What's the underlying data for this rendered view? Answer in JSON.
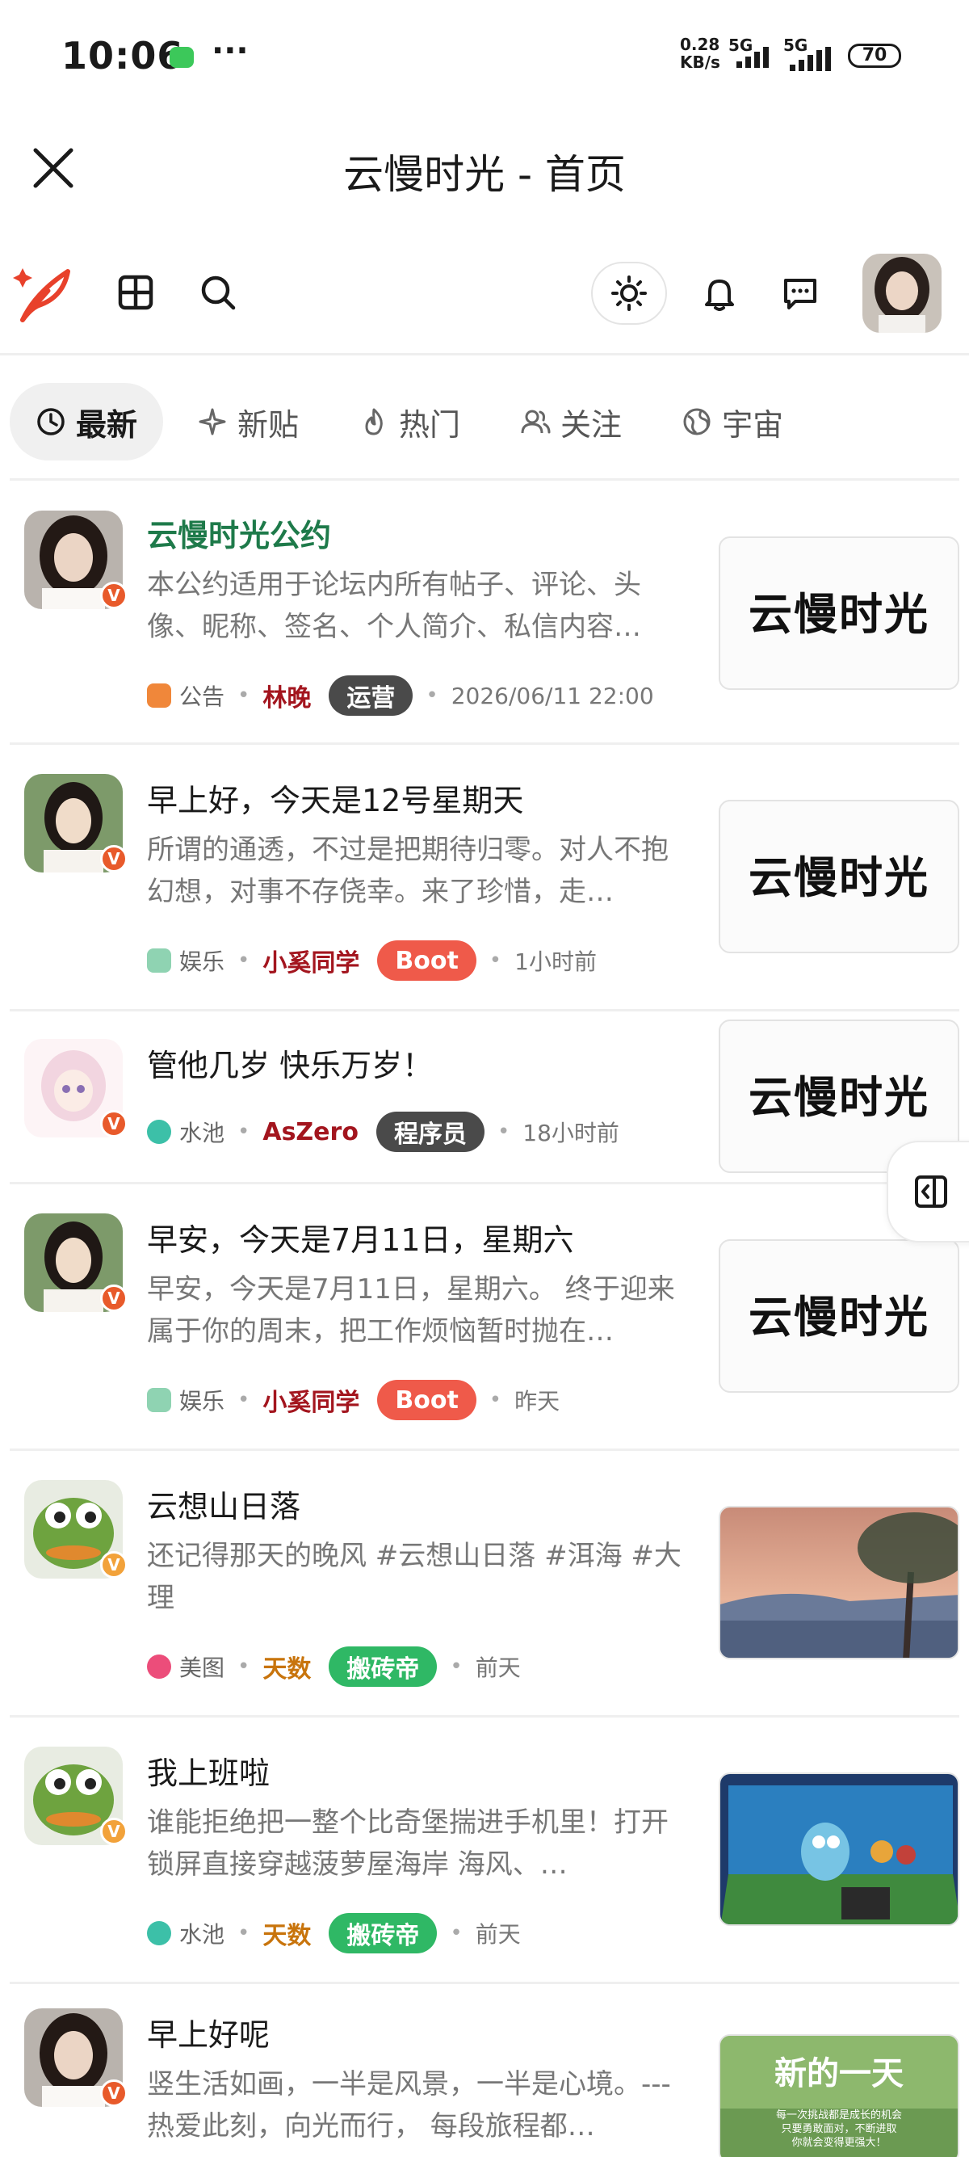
{
  "status": {
    "time": "10:06",
    "speed_top": "0.28",
    "speed_bottom": "KB/s",
    "sig1": "5G",
    "sig2": "5G",
    "battery": "70"
  },
  "header": {
    "title": "云慢时光 - 首页"
  },
  "tabs": [
    {
      "label": "最新",
      "icon": "clock-icon",
      "active": true
    },
    {
      "label": "新贴",
      "icon": "sparkle-icon",
      "active": false
    },
    {
      "label": "热门",
      "icon": "flame-icon",
      "active": false
    },
    {
      "label": "关注",
      "icon": "users-icon",
      "active": false
    },
    {
      "label": "宇宙",
      "icon": "globe-icon",
      "active": false
    }
  ],
  "posts": [
    {
      "title": "云慢时光公约",
      "excerpt": "本公约适用于论坛内所有帖子、评论、头像、昵称、签名、个人简介、私信内容…",
      "category": "公告",
      "author": "林晚",
      "role": "运营",
      "time": "2026/06/11 22:00"
    },
    {
      "title": "早上好，今天是12号星期天",
      "excerpt": "所谓的通透，不过是把期待归零。对人不抱幻想，对事不存侥幸。来了珍惜，走…",
      "category": "娱乐",
      "author": "小奚同学",
      "role": "Boot",
      "time": "1小时前"
    },
    {
      "title": "管他几岁 快乐万岁！",
      "excerpt": "",
      "category": "水池",
      "author": "AsZero",
      "role": "程序员",
      "time": "18小时前"
    },
    {
      "title": "早安，今天是7月11日，星期六",
      "excerpt": "早安，今天是7月11日，星期六。 终于迎来属于你的周末，把工作烦恼暂时抛在…",
      "category": "娱乐",
      "author": "小奚同学",
      "role": "Boot",
      "time": "昨天"
    },
    {
      "title": "云想山日落",
      "excerpt": "还记得那天的晚风 #云想山日落 #洱海 #大理",
      "category": "美图",
      "author": "天数",
      "role": "搬砖帝",
      "time": "前天"
    },
    {
      "title": "我上班啦",
      "excerpt": "谁能拒绝把一整个比奇堡揣进手机里！打开锁屏直接穿越菠萝屋海岸 海风、…",
      "category": "水池",
      "author": "天数",
      "role": "搬砖帝",
      "time": "前天"
    },
    {
      "title": "早上好呢",
      "excerpt": "竖生活如画，一半是风景，一半是心境。--- 热爱此刻，向光而行， 每段旅程都…",
      "category": "",
      "author": "",
      "role": "",
      "time": ""
    }
  ],
  "thumb_brand": "云慢时光",
  "thumb_last": {
    "line1": "新的一天",
    "line2": "每一次挑战都是成长的机会",
    "line3": "只要勇敢面对，不断进取",
    "line4": "你就会变得更强大！"
  },
  "colors": {
    "accent": "#e8412b",
    "green_title": "#1e7a4a",
    "boot": "#ef5a4a",
    "brick": "#2fb865",
    "ops": "#4a4a4a"
  }
}
